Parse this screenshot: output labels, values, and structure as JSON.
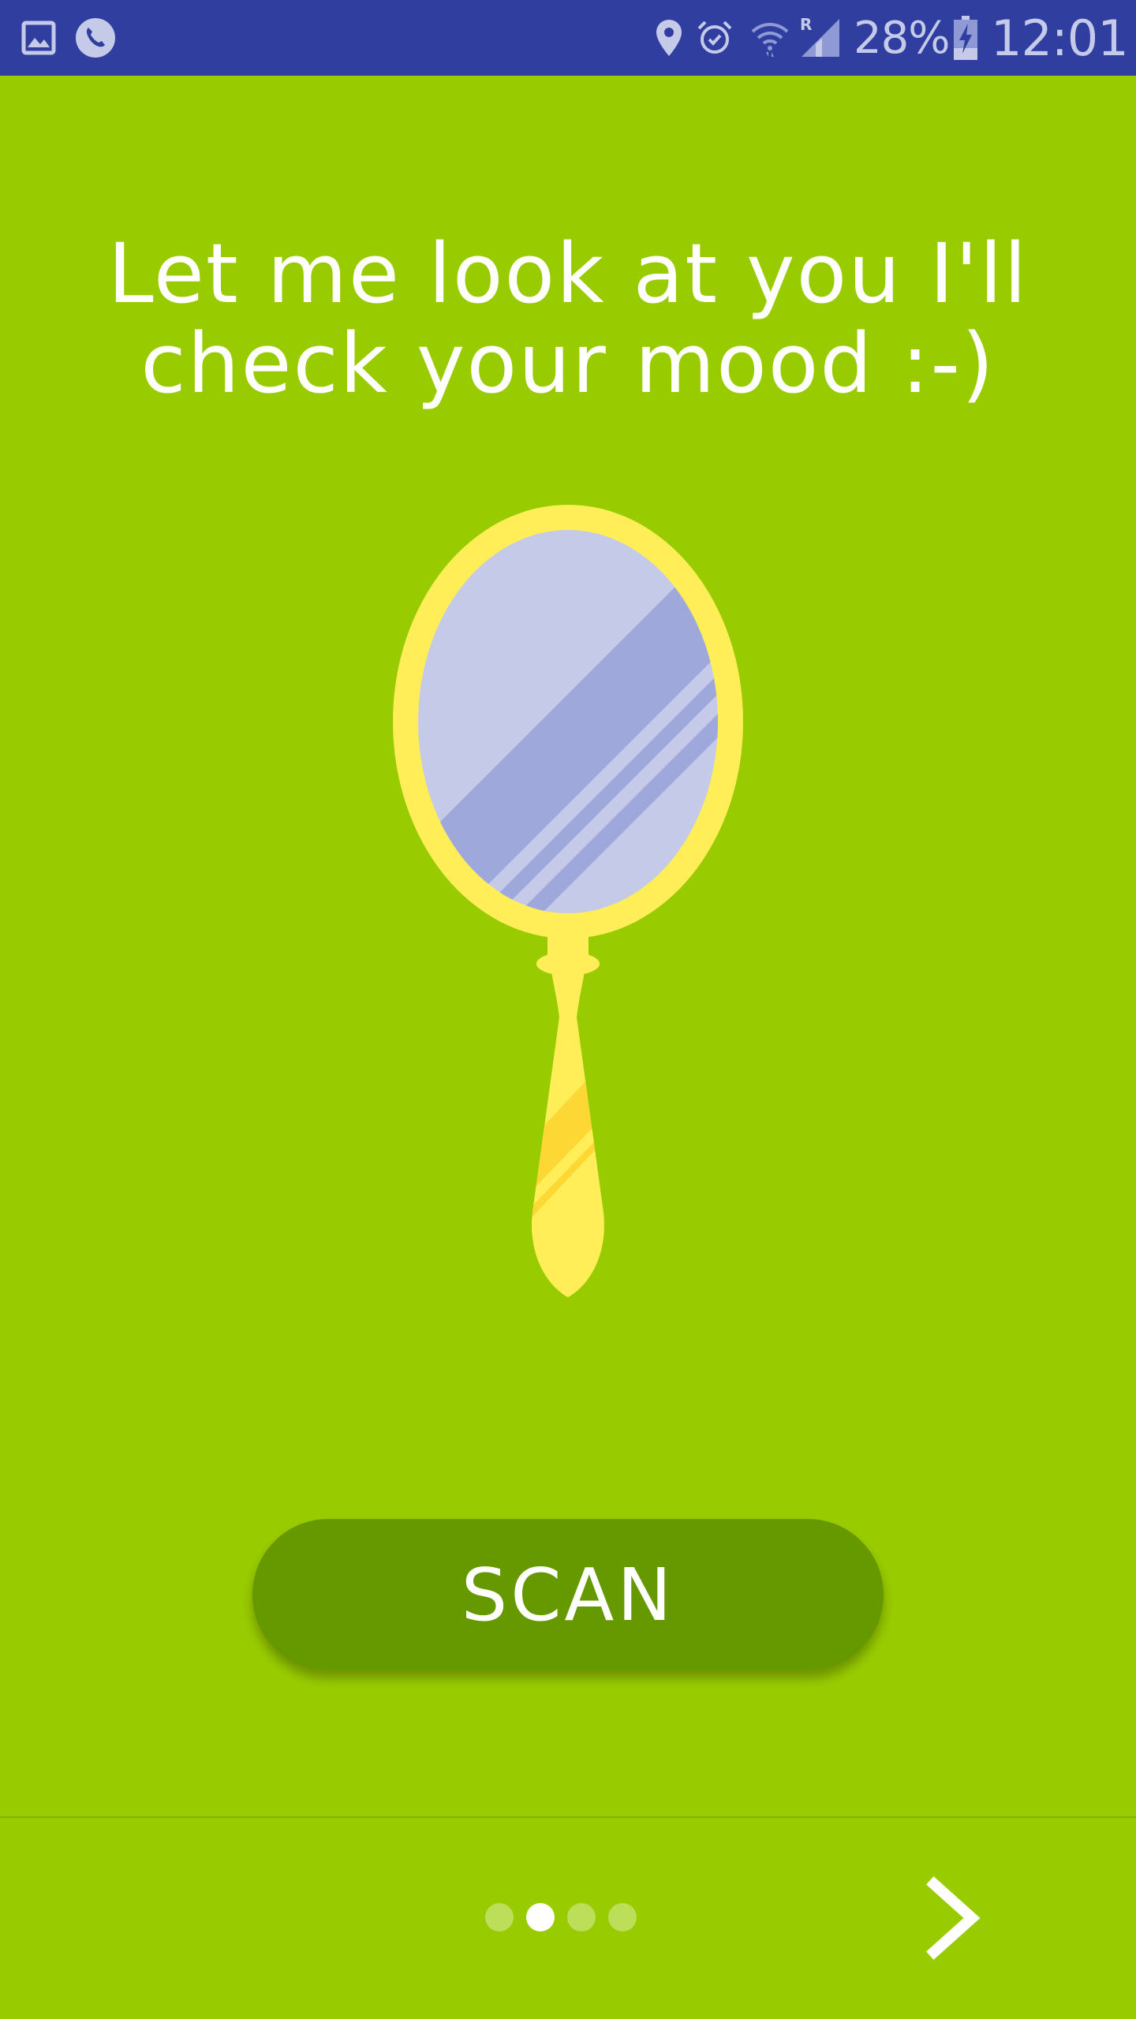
{
  "status_bar": {
    "battery": "28%",
    "time": "12:01",
    "icons": [
      "gallery-icon",
      "phone-call-icon",
      "location-pin-icon",
      "alarm-icon",
      "wifi-icon",
      "roaming-signal-icon",
      "battery-charging-icon"
    ]
  },
  "onboarding": {
    "headline": "Let me look at you I'll check your mood :-)",
    "illustration": "hand-mirror-icon",
    "scan_label": "SCAN",
    "page_indicator": {
      "total": 4,
      "current": 2
    },
    "next_icon": "chevron-right-icon"
  },
  "colors": {
    "background": "#99cc00",
    "status_bar": "#303f9f",
    "button": "#669900",
    "mirror_frame": "#ffee58",
    "mirror_glass": "#c5cae9"
  }
}
